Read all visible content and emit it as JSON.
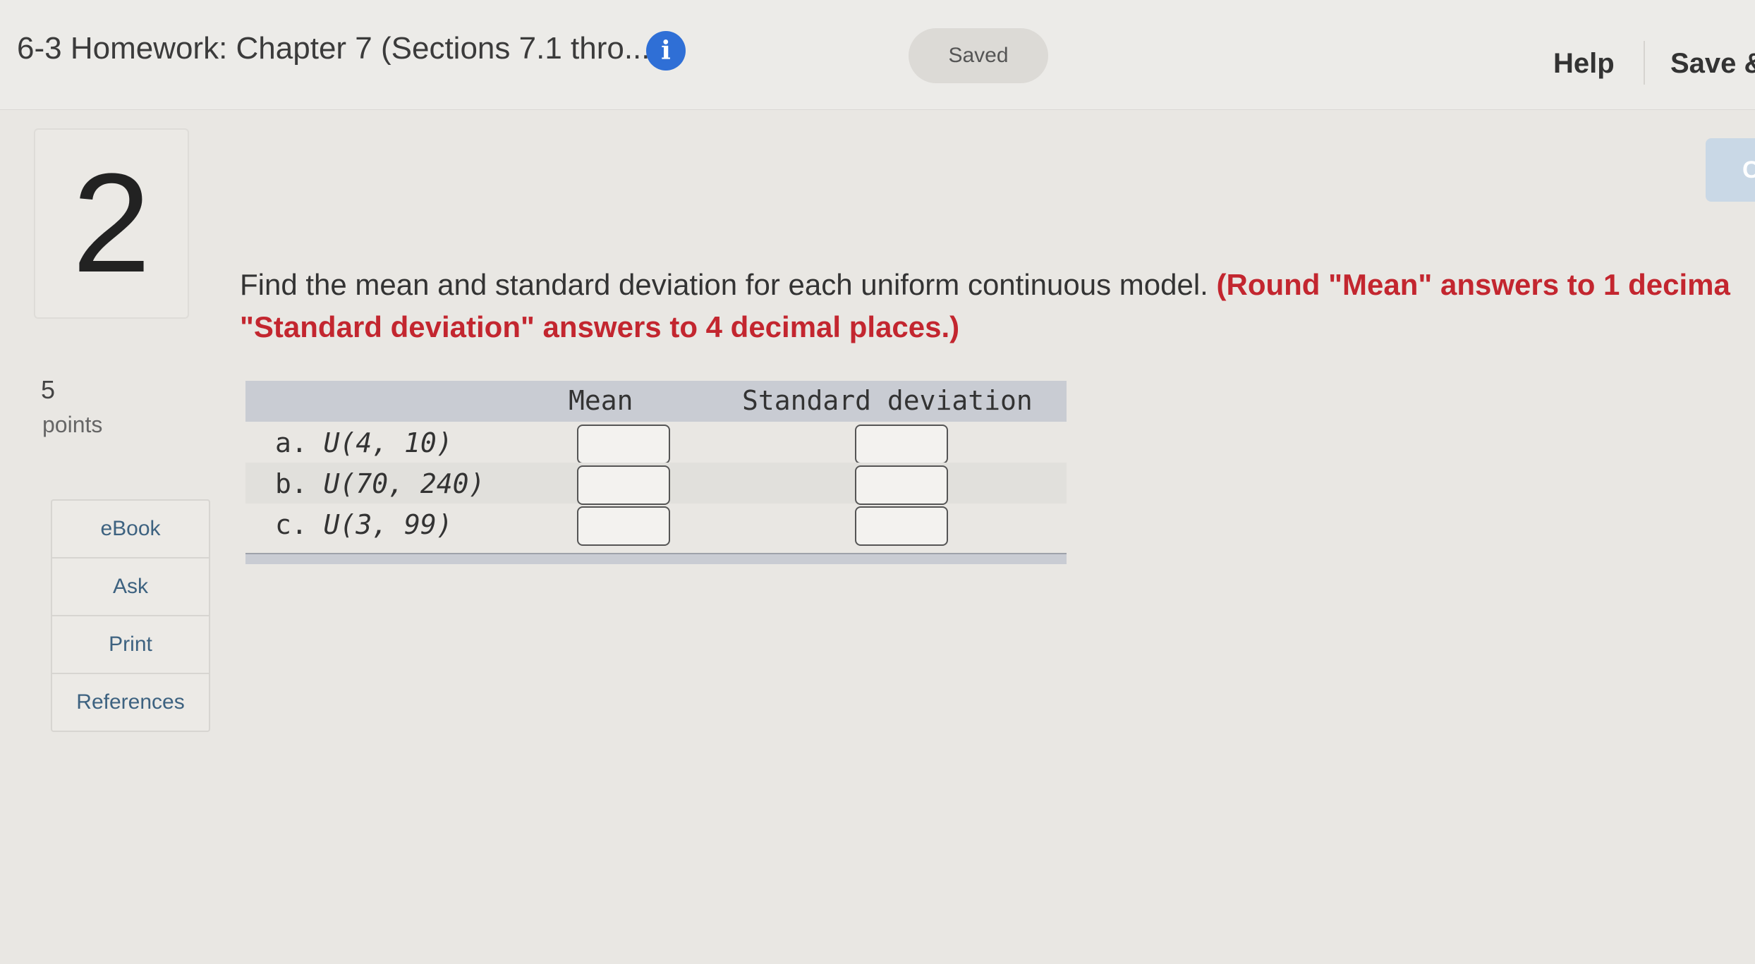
{
  "header": {
    "title": "6-3 Homework: Chapter 7 (Sections 7.1 thro...",
    "info_icon": "info-icon",
    "saved_label": "Saved",
    "help_label": "Help",
    "save_exit_label": "Save &",
    "next_partial": "C"
  },
  "question": {
    "number": "2",
    "points_value": "5",
    "points_label": "points",
    "prompt": "Find the mean and standard deviation for each uniform continuous model.",
    "instruction_line1": "(Round \"Mean\" answers to 1 decima",
    "instruction_line2": "\"Standard deviation\" answers to 4 decimal places.)"
  },
  "tools": {
    "items": [
      {
        "label": "eBook"
      },
      {
        "label": "Ask"
      },
      {
        "label": "Print"
      },
      {
        "label": "References"
      }
    ]
  },
  "table": {
    "headers": {
      "mean": "Mean",
      "sd": "Standard deviation"
    },
    "rows": [
      {
        "prefix": "a.",
        "model": "U(4, 10)",
        "mean": "",
        "sd": ""
      },
      {
        "prefix": "b.",
        "model": "U(70, 240)",
        "mean": "",
        "sd": ""
      },
      {
        "prefix": "c.",
        "model": "U(3, 99)",
        "mean": "",
        "sd": ""
      }
    ]
  },
  "colors": {
    "accent_blue": "#2f6fd6",
    "instruction_red": "#c3262f",
    "link_blue": "#3d6280"
  }
}
